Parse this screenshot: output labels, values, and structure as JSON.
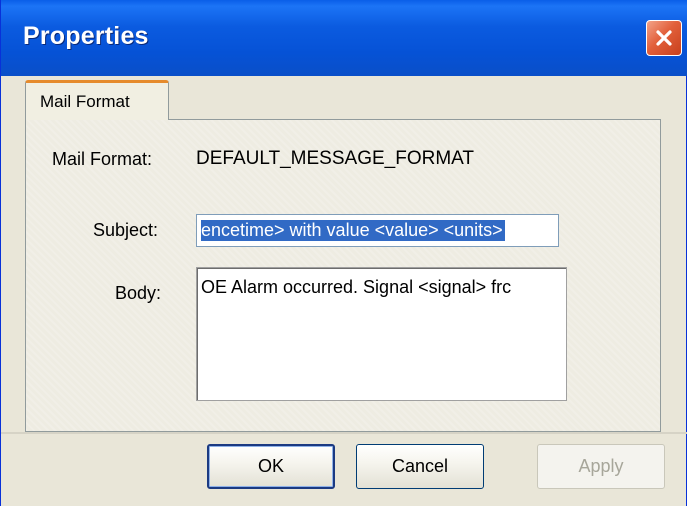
{
  "window": {
    "title": "Properties"
  },
  "tabs": [
    {
      "label": "Mail Format",
      "active": true
    }
  ],
  "form": {
    "mail_format_label": "Mail Format:",
    "mail_format_value": "DEFAULT_MESSAGE_FORMAT",
    "subject_label": "Subject:",
    "subject_value": "encetime> with value <value> <units>",
    "body_label": "Body:",
    "body_value": "OE Alarm occurred. Signal <signal> frc"
  },
  "buttons": {
    "ok": "OK",
    "cancel": "Cancel",
    "apply": "Apply"
  },
  "colors": {
    "titlebar": "#0a5ee8",
    "close": "#e2603b",
    "selection": "#316ac5",
    "tab_highlight": "#e68b2c"
  },
  "icons": {
    "close": "close-icon"
  }
}
